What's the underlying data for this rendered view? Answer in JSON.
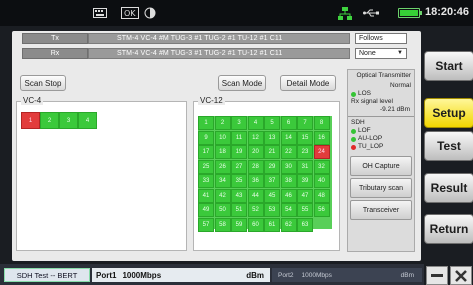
{
  "status": {
    "time": "18:20:46",
    "icons": [
      "keyboard-icon",
      "screenshot-icon",
      "contrast-icon",
      "network-icon",
      "usb-icon",
      "battery-icon"
    ]
  },
  "path": {
    "tx_label": "Tx",
    "rx_label": "Rx",
    "tx_path": "STM-4  VC-4 #M  TUG-3 #1  TUG-2 #1  TU-12 #1  C11",
    "rx_path": "STM-4  VC-4 #M  TUG-3 #1  TUG-2 #1  TU-12 #1  C11",
    "tx_option": "Follows",
    "rx_option": "None"
  },
  "controls": {
    "scan_stop": "Scan Stop",
    "scan_mode": "Scan Mode",
    "detail_mode": "Detail Mode"
  },
  "vc4": {
    "label": "VC-4",
    "cells": [
      {
        "n": "1",
        "state": "alarm"
      },
      {
        "n": "2",
        "state": "ok"
      },
      {
        "n": "3",
        "state": "ok"
      },
      {
        "n": "4",
        "state": "ok"
      }
    ]
  },
  "vc12": {
    "label": "VC-12",
    "alarm_cells": [
      "24"
    ],
    "cells": [
      "1",
      "2",
      "3",
      "4",
      "5",
      "6",
      "7",
      "8",
      "9",
      "10",
      "11",
      "12",
      "13",
      "14",
      "15",
      "16",
      "17",
      "18",
      "19",
      "20",
      "21",
      "22",
      "23",
      "24",
      "25",
      "26",
      "27",
      "28",
      "29",
      "30",
      "31",
      "32",
      "33",
      "34",
      "35",
      "36",
      "37",
      "38",
      "39",
      "40",
      "41",
      "42",
      "43",
      "44",
      "45",
      "46",
      "47",
      "48",
      "49",
      "50",
      "51",
      "52",
      "53",
      "54",
      "55",
      "56",
      "57",
      "58",
      "59",
      "60",
      "61",
      "62",
      "63"
    ]
  },
  "info": {
    "optical_title": "Optical Transmitter",
    "optical_state": "Normal",
    "los": "LOS",
    "rx_signal_label": "Rx signal level",
    "rx_signal_value": "-9.21 dBm",
    "sdh_title": "SDH",
    "lof": "LOF",
    "au_lop": "AU-LOP",
    "tu_lop": "TU_LOP",
    "oh_capture": "OH Capture",
    "tributary_scan": "Tributary scan",
    "transceiver": "Transceiver"
  },
  "nav": {
    "start": "Start",
    "setup": "Setup",
    "test": "Test",
    "result": "Result",
    "return": "Return"
  },
  "bottom": {
    "mode": "SDH Test -- BERT",
    "port1": "Port1",
    "port1_speed": "1000Mbps",
    "port1_unit": "dBm",
    "port2": "Port2",
    "port2_speed": "1000Mbps",
    "port2_unit": "dBm"
  },
  "colors": {
    "ok": "#3bc93b",
    "alarm": "#e23c3c",
    "active_nav": "#f2d600"
  }
}
